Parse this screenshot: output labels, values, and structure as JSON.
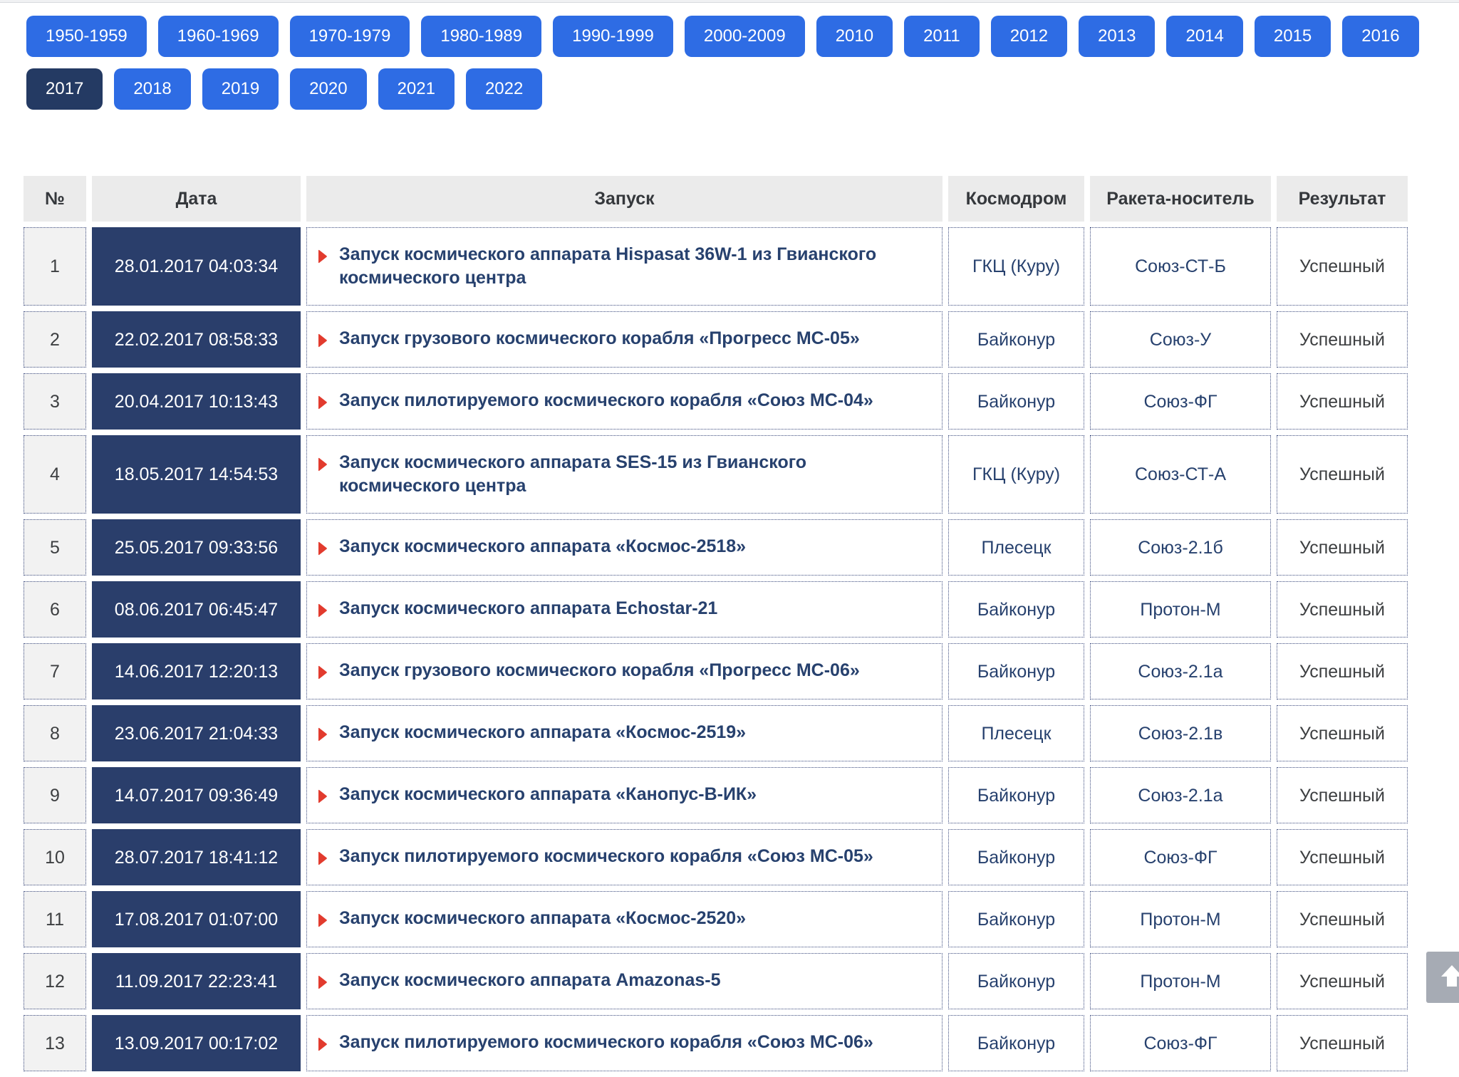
{
  "filters": {
    "active": "2017",
    "row1": [
      "1950-1959",
      "1960-1969",
      "1970-1979",
      "1980-1989",
      "1990-1999",
      "2000-2009",
      "2010",
      "2011",
      "2012",
      "2013",
      "2014",
      "2015",
      "2016"
    ],
    "row2": [
      "2017",
      "2018",
      "2019",
      "2020",
      "2021",
      "2022"
    ]
  },
  "table": {
    "columns": [
      "№",
      "Дата",
      "Запуск",
      "Космодром",
      "Ракета-носитель",
      "Результат"
    ],
    "rows": [
      {
        "num": "1",
        "date": "28.01.2017 04:03:34",
        "launch": "Запуск космического аппарата Hispasat 36W-1 из Гвианского\nкосмического центра",
        "site": "ГКЦ (Куру)",
        "rocket": "Союз-СТ-Б",
        "result": "Успешный"
      },
      {
        "num": "2",
        "date": "22.02.2017 08:58:33",
        "launch": "Запуск грузового космического корабля «Прогресс МС-05»",
        "site": "Байконур",
        "rocket": "Союз-У",
        "result": "Успешный"
      },
      {
        "num": "3",
        "date": "20.04.2017 10:13:43",
        "launch": "Запуск пилотируемого космического корабля «Союз МС-04»",
        "site": "Байконур",
        "rocket": "Союз-ФГ",
        "result": "Успешный"
      },
      {
        "num": "4",
        "date": "18.05.2017 14:54:53",
        "launch": "Запуск космического аппарата SES-15 из Гвианского\nкосмического центра",
        "site": "ГКЦ (Куру)",
        "rocket": "Союз-СТ-А",
        "result": "Успешный"
      },
      {
        "num": "5",
        "date": "25.05.2017 09:33:56",
        "launch": "Запуск космического аппарата «Космос-2518»",
        "site": "Плесецк",
        "rocket": "Союз-2.1б",
        "result": "Успешный"
      },
      {
        "num": "6",
        "date": "08.06.2017 06:45:47",
        "launch": "Запуск космического аппарата Echostar-21",
        "site": "Байконур",
        "rocket": "Протон-М",
        "result": "Успешный"
      },
      {
        "num": "7",
        "date": "14.06.2017 12:20:13",
        "launch": "Запуск грузового космического корабля «Прогресс МС-06»",
        "site": "Байконур",
        "rocket": "Союз-2.1а",
        "result": "Успешный"
      },
      {
        "num": "8",
        "date": "23.06.2017 21:04:33",
        "launch": "Запуск космического аппарата «Космос-2519»",
        "site": "Плесецк",
        "rocket": "Союз-2.1в",
        "result": "Успешный"
      },
      {
        "num": "9",
        "date": "14.07.2017 09:36:49",
        "launch": "Запуск космического аппарата «Канопус-В-ИК»",
        "site": "Байконур",
        "rocket": "Союз-2.1а",
        "result": "Успешный"
      },
      {
        "num": "10",
        "date": "28.07.2017 18:41:12",
        "launch": "Запуск пилотируемого космического корабля «Союз МС-05»",
        "site": "Байконур",
        "rocket": "Союз-ФГ",
        "result": "Успешный"
      },
      {
        "num": "11",
        "date": "17.08.2017 01:07:00",
        "launch": "Запуск космического аппарата «Космос-2520»",
        "site": "Байконур",
        "rocket": "Протон-М",
        "result": "Успешный"
      },
      {
        "num": "12",
        "date": "11.09.2017 22:23:41",
        "launch": "Запуск космического аппарата Amazonas-5",
        "site": "Байконур",
        "rocket": "Протон-М",
        "result": "Успешный"
      },
      {
        "num": "13",
        "date": "13.09.2017 00:17:02",
        "launch": "Запуск пилотируемого космического корабля «Союз МС-06»",
        "site": "Байконур",
        "rocket": "Союз-ФГ",
        "result": "Успешный"
      }
    ]
  },
  "icons": {
    "launch_marker": "red-play-triangle",
    "scroll_top": "up-arrow"
  },
  "colors": {
    "accent_blue": "#2e6ce4",
    "active_year_navy": "#243a63",
    "date_cell_navy": "#2a3e6b",
    "link_navy": "#27416e",
    "marker_red": "#e23b2e",
    "header_gray": "#ebebeb",
    "num_cell_gray": "#f2f2f2",
    "dotted_border": "#3c4b7e",
    "scroll_button_gray": "#a6abb4"
  }
}
